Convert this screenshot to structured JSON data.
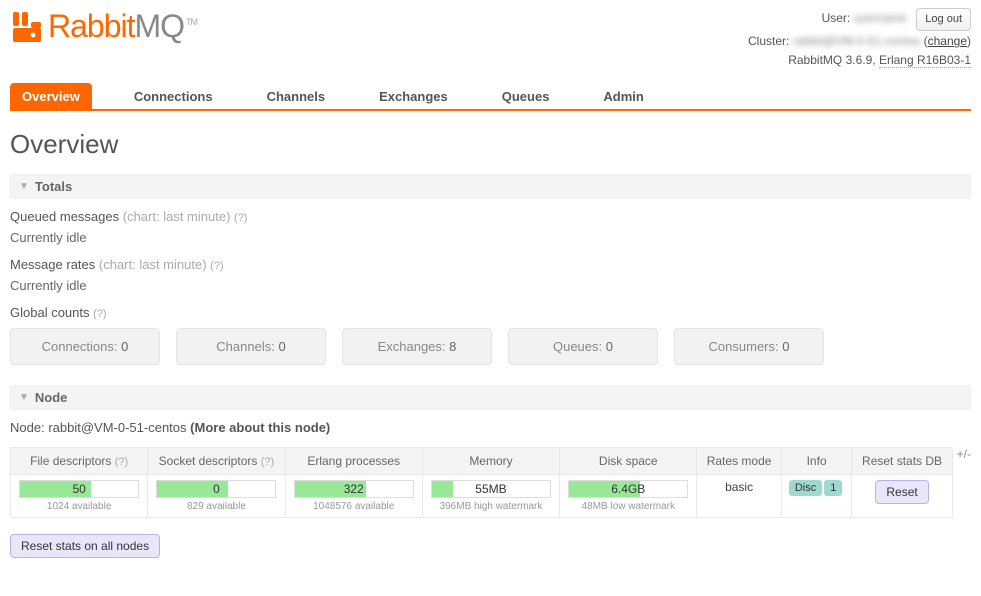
{
  "header": {
    "user_label": "User:",
    "user_value": "username",
    "cluster_label": "Cluster:",
    "cluster_value": "rabbit@VM-0-51-centos",
    "change_label": "change",
    "version_text": "RabbitMQ 3.6.9,",
    "erlang_text": "Erlang R16B03-1",
    "logout_label": "Log out",
    "logo_strong": "Rabbit",
    "logo_light": "MQ",
    "logo_tm": "TM"
  },
  "tabs": {
    "overview": "Overview",
    "connections": "Connections",
    "channels": "Channels",
    "exchanges": "Exchanges",
    "queues": "Queues",
    "admin": "Admin"
  },
  "page_title": "Overview",
  "sections": {
    "totals": "Totals",
    "node": "Node"
  },
  "totals": {
    "queued_label": "Queued messages",
    "queued_hint": "(chart: last minute)",
    "help": "(?)",
    "idle1": "Currently idle",
    "rates_label": "Message rates",
    "rates_hint": "(chart: last minute)",
    "idle2": "Currently idle",
    "global_label": "Global counts",
    "counts": {
      "connections": {
        "label": "Connections:",
        "value": "0"
      },
      "channels": {
        "label": "Channels:",
        "value": "0"
      },
      "exchanges": {
        "label": "Exchanges:",
        "value": "8"
      },
      "queues": {
        "label": "Queues:",
        "value": "0"
      },
      "consumers": {
        "label": "Consumers:",
        "value": "0"
      }
    }
  },
  "node": {
    "name_label": "Node:",
    "name_value": "rabbit@VM-0-51-centos",
    "more_label": "(More about this node)",
    "headers": {
      "fd": "File descriptors",
      "sd": "Socket descriptors",
      "ep": "Erlang processes",
      "mem": "Memory",
      "disk": "Disk space",
      "rates": "Rates mode",
      "info": "Info",
      "reset": "Reset stats DB"
    },
    "row": {
      "fd": {
        "value": "50",
        "avail": "1024 available",
        "pct": 60
      },
      "sd": {
        "value": "0",
        "avail": "829 available",
        "pct": 60
      },
      "ep": {
        "value": "322",
        "avail": "1048576 available",
        "pct": 60
      },
      "mem": {
        "value": "55MB",
        "avail": "396MB high watermark",
        "pct": 18
      },
      "disk": {
        "value": "6.4GB",
        "avail": "48MB low watermark",
        "pct": 60
      },
      "rates": "basic",
      "info_disc": "Disc",
      "info_count": "1",
      "reset_btn": "Reset"
    },
    "reset_all": "Reset stats on all nodes",
    "plusminus": "+/-"
  }
}
